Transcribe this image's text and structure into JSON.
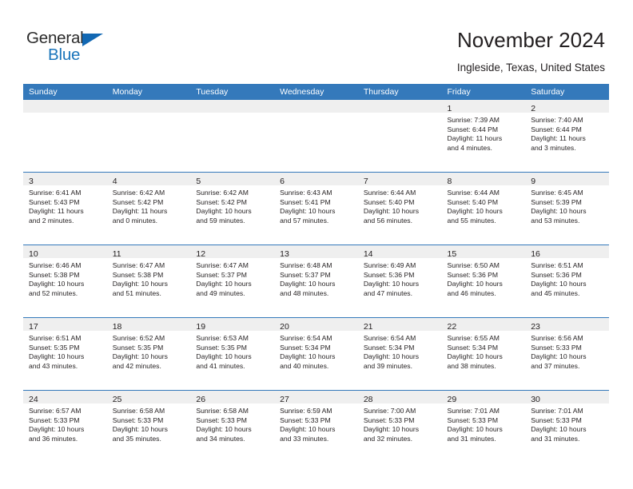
{
  "brand": {
    "name_top": "General",
    "name_bottom": "Blue",
    "accent_color": "#1b75bb",
    "triangle_color": "#1268b3"
  },
  "header": {
    "title": "November 2024",
    "subtitle": "Ingleside, Texas, United States"
  },
  "calendar": {
    "header_bg": "#3479bb",
    "header_text_color": "#ffffff",
    "daynum_band_bg": "#efefef",
    "row_separator_color": "#3479bb",
    "weekdays": [
      "Sunday",
      "Monday",
      "Tuesday",
      "Wednesday",
      "Thursday",
      "Friday",
      "Saturday"
    ],
    "weeks": [
      [
        {
          "day": "",
          "lines": []
        },
        {
          "day": "",
          "lines": []
        },
        {
          "day": "",
          "lines": []
        },
        {
          "day": "",
          "lines": []
        },
        {
          "day": "",
          "lines": []
        },
        {
          "day": "1",
          "lines": [
            "Sunrise: 7:39 AM",
            "Sunset: 6:44 PM",
            "Daylight: 11 hours",
            "and 4 minutes."
          ]
        },
        {
          "day": "2",
          "lines": [
            "Sunrise: 7:40 AM",
            "Sunset: 6:44 PM",
            "Daylight: 11 hours",
            "and 3 minutes."
          ]
        }
      ],
      [
        {
          "day": "3",
          "lines": [
            "Sunrise: 6:41 AM",
            "Sunset: 5:43 PM",
            "Daylight: 11 hours",
            "and 2 minutes."
          ]
        },
        {
          "day": "4",
          "lines": [
            "Sunrise: 6:42 AM",
            "Sunset: 5:42 PM",
            "Daylight: 11 hours",
            "and 0 minutes."
          ]
        },
        {
          "day": "5",
          "lines": [
            "Sunrise: 6:42 AM",
            "Sunset: 5:42 PM",
            "Daylight: 10 hours",
            "and 59 minutes."
          ]
        },
        {
          "day": "6",
          "lines": [
            "Sunrise: 6:43 AM",
            "Sunset: 5:41 PM",
            "Daylight: 10 hours",
            "and 57 minutes."
          ]
        },
        {
          "day": "7",
          "lines": [
            "Sunrise: 6:44 AM",
            "Sunset: 5:40 PM",
            "Daylight: 10 hours",
            "and 56 minutes."
          ]
        },
        {
          "day": "8",
          "lines": [
            "Sunrise: 6:44 AM",
            "Sunset: 5:40 PM",
            "Daylight: 10 hours",
            "and 55 minutes."
          ]
        },
        {
          "day": "9",
          "lines": [
            "Sunrise: 6:45 AM",
            "Sunset: 5:39 PM",
            "Daylight: 10 hours",
            "and 53 minutes."
          ]
        }
      ],
      [
        {
          "day": "10",
          "lines": [
            "Sunrise: 6:46 AM",
            "Sunset: 5:38 PM",
            "Daylight: 10 hours",
            "and 52 minutes."
          ]
        },
        {
          "day": "11",
          "lines": [
            "Sunrise: 6:47 AM",
            "Sunset: 5:38 PM",
            "Daylight: 10 hours",
            "and 51 minutes."
          ]
        },
        {
          "day": "12",
          "lines": [
            "Sunrise: 6:47 AM",
            "Sunset: 5:37 PM",
            "Daylight: 10 hours",
            "and 49 minutes."
          ]
        },
        {
          "day": "13",
          "lines": [
            "Sunrise: 6:48 AM",
            "Sunset: 5:37 PM",
            "Daylight: 10 hours",
            "and 48 minutes."
          ]
        },
        {
          "day": "14",
          "lines": [
            "Sunrise: 6:49 AM",
            "Sunset: 5:36 PM",
            "Daylight: 10 hours",
            "and 47 minutes."
          ]
        },
        {
          "day": "15",
          "lines": [
            "Sunrise: 6:50 AM",
            "Sunset: 5:36 PM",
            "Daylight: 10 hours",
            "and 46 minutes."
          ]
        },
        {
          "day": "16",
          "lines": [
            "Sunrise: 6:51 AM",
            "Sunset: 5:36 PM",
            "Daylight: 10 hours",
            "and 45 minutes."
          ]
        }
      ],
      [
        {
          "day": "17",
          "lines": [
            "Sunrise: 6:51 AM",
            "Sunset: 5:35 PM",
            "Daylight: 10 hours",
            "and 43 minutes."
          ]
        },
        {
          "day": "18",
          "lines": [
            "Sunrise: 6:52 AM",
            "Sunset: 5:35 PM",
            "Daylight: 10 hours",
            "and 42 minutes."
          ]
        },
        {
          "day": "19",
          "lines": [
            "Sunrise: 6:53 AM",
            "Sunset: 5:35 PM",
            "Daylight: 10 hours",
            "and 41 minutes."
          ]
        },
        {
          "day": "20",
          "lines": [
            "Sunrise: 6:54 AM",
            "Sunset: 5:34 PM",
            "Daylight: 10 hours",
            "and 40 minutes."
          ]
        },
        {
          "day": "21",
          "lines": [
            "Sunrise: 6:54 AM",
            "Sunset: 5:34 PM",
            "Daylight: 10 hours",
            "and 39 minutes."
          ]
        },
        {
          "day": "22",
          "lines": [
            "Sunrise: 6:55 AM",
            "Sunset: 5:34 PM",
            "Daylight: 10 hours",
            "and 38 minutes."
          ]
        },
        {
          "day": "23",
          "lines": [
            "Sunrise: 6:56 AM",
            "Sunset: 5:33 PM",
            "Daylight: 10 hours",
            "and 37 minutes."
          ]
        }
      ],
      [
        {
          "day": "24",
          "lines": [
            "Sunrise: 6:57 AM",
            "Sunset: 5:33 PM",
            "Daylight: 10 hours",
            "and 36 minutes."
          ]
        },
        {
          "day": "25",
          "lines": [
            "Sunrise: 6:58 AM",
            "Sunset: 5:33 PM",
            "Daylight: 10 hours",
            "and 35 minutes."
          ]
        },
        {
          "day": "26",
          "lines": [
            "Sunrise: 6:58 AM",
            "Sunset: 5:33 PM",
            "Daylight: 10 hours",
            "and 34 minutes."
          ]
        },
        {
          "day": "27",
          "lines": [
            "Sunrise: 6:59 AM",
            "Sunset: 5:33 PM",
            "Daylight: 10 hours",
            "and 33 minutes."
          ]
        },
        {
          "day": "28",
          "lines": [
            "Sunrise: 7:00 AM",
            "Sunset: 5:33 PM",
            "Daylight: 10 hours",
            "and 32 minutes."
          ]
        },
        {
          "day": "29",
          "lines": [
            "Sunrise: 7:01 AM",
            "Sunset: 5:33 PM",
            "Daylight: 10 hours",
            "and 31 minutes."
          ]
        },
        {
          "day": "30",
          "lines": [
            "Sunrise: 7:01 AM",
            "Sunset: 5:33 PM",
            "Daylight: 10 hours",
            "and 31 minutes."
          ]
        }
      ]
    ]
  }
}
